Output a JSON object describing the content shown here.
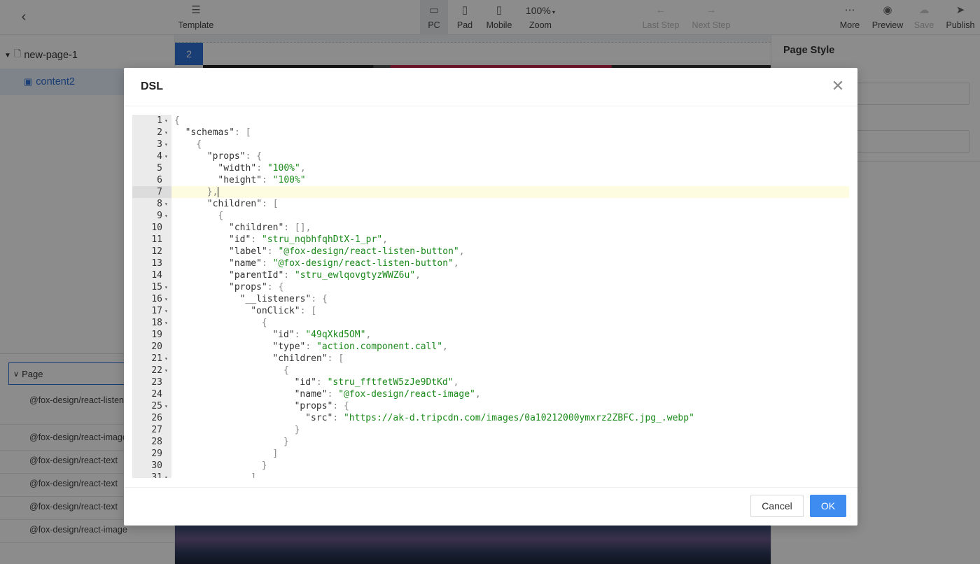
{
  "toolbar": {
    "back_icon": "chevron-left-icon",
    "template": "Template",
    "pc": "PC",
    "pad": "Pad",
    "mobile": "Mobile",
    "zoom_value": "100%",
    "zoom": "Zoom",
    "last_step": "Last Step",
    "next_step": "Next Step",
    "more": "More",
    "preview": "Preview",
    "save": "Save",
    "publish": "Publish"
  },
  "tree": {
    "page": "new-page-1",
    "child": "content2"
  },
  "components": {
    "page_label": "Page",
    "items": [
      "@fox-design/react-listen-button",
      "@fox-design/react-image",
      "@fox-design/react-text",
      "@fox-design/react-text",
      "@fox-design/react-text",
      "@fox-design/react-image"
    ]
  },
  "canvas": {
    "badge": "2"
  },
  "right_panel": {
    "title": "Page Style"
  },
  "modal": {
    "title": "DSL",
    "cancel": "Cancel",
    "ok": "OK",
    "active_line": 7,
    "lines": [
      {
        "n": "1",
        "fold": true,
        "indent": 0,
        "tokens": [
          [
            "p",
            "{"
          ]
        ]
      },
      {
        "n": "2",
        "fold": true,
        "indent": 1,
        "tokens": [
          [
            "k",
            "\"schemas\""
          ],
          [
            "p",
            ": ["
          ]
        ]
      },
      {
        "n": "3",
        "fold": true,
        "indent": 2,
        "tokens": [
          [
            "p",
            "{"
          ]
        ]
      },
      {
        "n": "4",
        "fold": true,
        "indent": 3,
        "tokens": [
          [
            "k",
            "\"props\""
          ],
          [
            "p",
            ": {"
          ]
        ]
      },
      {
        "n": "5",
        "fold": false,
        "indent": 4,
        "tokens": [
          [
            "k",
            "\"width\""
          ],
          [
            "p",
            ": "
          ],
          [
            "s",
            "\"100%\""
          ],
          [
            "p",
            ","
          ]
        ]
      },
      {
        "n": "6",
        "fold": false,
        "indent": 4,
        "tokens": [
          [
            "k",
            "\"height\""
          ],
          [
            "p",
            ": "
          ],
          [
            "s",
            "\"100%\""
          ]
        ]
      },
      {
        "n": "7",
        "fold": false,
        "indent": 3,
        "tokens": [
          [
            "p",
            "},"
          ]
        ],
        "caret": true
      },
      {
        "n": "8",
        "fold": true,
        "indent": 3,
        "tokens": [
          [
            "k",
            "\"children\""
          ],
          [
            "p",
            ": ["
          ]
        ]
      },
      {
        "n": "9",
        "fold": true,
        "indent": 4,
        "tokens": [
          [
            "p",
            "{"
          ]
        ]
      },
      {
        "n": "10",
        "fold": false,
        "indent": 5,
        "tokens": [
          [
            "k",
            "\"children\""
          ],
          [
            "p",
            ": [],"
          ]
        ]
      },
      {
        "n": "11",
        "fold": false,
        "indent": 5,
        "tokens": [
          [
            "k",
            "\"id\""
          ],
          [
            "p",
            ": "
          ],
          [
            "s",
            "\"stru_nqbhfqhDtX-1_pr\""
          ],
          [
            "p",
            ","
          ]
        ]
      },
      {
        "n": "12",
        "fold": false,
        "indent": 5,
        "tokens": [
          [
            "k",
            "\"label\""
          ],
          [
            "p",
            ": "
          ],
          [
            "s",
            "\"@fox-design/react-listen-button\""
          ],
          [
            "p",
            ","
          ]
        ]
      },
      {
        "n": "13",
        "fold": false,
        "indent": 5,
        "tokens": [
          [
            "k",
            "\"name\""
          ],
          [
            "p",
            ": "
          ],
          [
            "s",
            "\"@fox-design/react-listen-button\""
          ],
          [
            "p",
            ","
          ]
        ]
      },
      {
        "n": "14",
        "fold": false,
        "indent": 5,
        "tokens": [
          [
            "k",
            "\"parentId\""
          ],
          [
            "p",
            ": "
          ],
          [
            "s",
            "\"stru_ewlqovgtyzWWZ6u\""
          ],
          [
            "p",
            ","
          ]
        ]
      },
      {
        "n": "15",
        "fold": true,
        "indent": 5,
        "tokens": [
          [
            "k",
            "\"props\""
          ],
          [
            "p",
            ": {"
          ]
        ]
      },
      {
        "n": "16",
        "fold": true,
        "indent": 6,
        "tokens": [
          [
            "k",
            "\"__listeners\""
          ],
          [
            "p",
            ": {"
          ]
        ]
      },
      {
        "n": "17",
        "fold": true,
        "indent": 7,
        "tokens": [
          [
            "k",
            "\"onClick\""
          ],
          [
            "p",
            ": ["
          ]
        ]
      },
      {
        "n": "18",
        "fold": true,
        "indent": 8,
        "tokens": [
          [
            "p",
            "{"
          ]
        ]
      },
      {
        "n": "19",
        "fold": false,
        "indent": 9,
        "tokens": [
          [
            "k",
            "\"id\""
          ],
          [
            "p",
            ": "
          ],
          [
            "s",
            "\"49qXkd5OM\""
          ],
          [
            "p",
            ","
          ]
        ]
      },
      {
        "n": "20",
        "fold": false,
        "indent": 9,
        "tokens": [
          [
            "k",
            "\"type\""
          ],
          [
            "p",
            ": "
          ],
          [
            "s",
            "\"action.component.call\""
          ],
          [
            "p",
            ","
          ]
        ]
      },
      {
        "n": "21",
        "fold": true,
        "indent": 9,
        "tokens": [
          [
            "k",
            "\"children\""
          ],
          [
            "p",
            ": ["
          ]
        ]
      },
      {
        "n": "22",
        "fold": true,
        "indent": 10,
        "tokens": [
          [
            "p",
            "{"
          ]
        ]
      },
      {
        "n": "23",
        "fold": false,
        "indent": 11,
        "tokens": [
          [
            "k",
            "\"id\""
          ],
          [
            "p",
            ": "
          ],
          [
            "s",
            "\"stru_fftfetW5zJe9DtKd\""
          ],
          [
            "p",
            ","
          ]
        ]
      },
      {
        "n": "24",
        "fold": false,
        "indent": 11,
        "tokens": [
          [
            "k",
            "\"name\""
          ],
          [
            "p",
            ": "
          ],
          [
            "s",
            "\"@fox-design/react-image\""
          ],
          [
            "p",
            ","
          ]
        ]
      },
      {
        "n": "25",
        "fold": true,
        "indent": 11,
        "tokens": [
          [
            "k",
            "\"props\""
          ],
          [
            "p",
            ": {"
          ]
        ]
      },
      {
        "n": "26",
        "fold": false,
        "indent": 12,
        "tokens": [
          [
            "k",
            "\"src\""
          ],
          [
            "p",
            ": "
          ],
          [
            "s",
            "\"https://ak-d.tripcdn.com/images/0a10212000ymxrz2ZBFC.jpg_.webp\""
          ]
        ]
      },
      {
        "n": "27",
        "fold": false,
        "indent": 11,
        "tokens": [
          [
            "p",
            "}"
          ]
        ]
      },
      {
        "n": "28",
        "fold": false,
        "indent": 10,
        "tokens": [
          [
            "p",
            "}"
          ]
        ]
      },
      {
        "n": "29",
        "fold": false,
        "indent": 9,
        "tokens": [
          [
            "p",
            "]"
          ]
        ]
      },
      {
        "n": "30",
        "fold": false,
        "indent": 8,
        "tokens": [
          [
            "p",
            "}"
          ]
        ]
      },
      {
        "n": "31",
        "fold": true,
        "indent": 7,
        "tokens": [
          [
            "p",
            "]"
          ]
        ]
      }
    ]
  }
}
